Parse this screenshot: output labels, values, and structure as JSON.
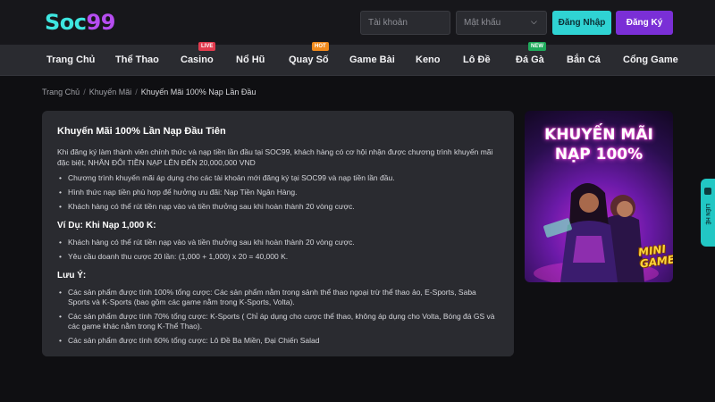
{
  "brand": {
    "logo_part1": "Soc",
    "logo_part2": "99"
  },
  "auth": {
    "username_placeholder": "Tài khoản",
    "password_placeholder": "Mật khẩu",
    "login_label": "Đăng Nhập",
    "register_label": "Đăng Ký"
  },
  "nav": {
    "items": [
      {
        "label": "Trang Chủ"
      },
      {
        "label": "Thể Thao"
      },
      {
        "label": "Casino",
        "badge": "LIVE"
      },
      {
        "label": "Nổ Hũ"
      },
      {
        "label": "Quay Số",
        "badge": "HOT"
      },
      {
        "label": "Game Bài"
      },
      {
        "label": "Keno"
      },
      {
        "label": "Lô Đề"
      },
      {
        "label": "Đá Gà",
        "badge": "NEW"
      },
      {
        "label": "Bắn Cá"
      },
      {
        "label": "Cổng Game"
      }
    ]
  },
  "breadcrumb": {
    "home": "Trang Chủ",
    "section": "Khuyến Mãi",
    "current": "Khuyến Mãi 100% Nạp Lần Đầu"
  },
  "article": {
    "title": "Khuyến Mãi 100% Lần Nạp Đầu Tiên",
    "intro": "Khi đăng ký làm thành viên chính thức và nạp tiền lần đầu tại SOC99, khách hàng có cơ hội nhận được chương trình khuyến mãi đặc biệt, NHÂN ĐÔI TIỀN NẠP LÊN ĐẾN 20,000,000 VND",
    "bullets": [
      "Chương trình khuyến mãi áp dụng cho các tài khoản mới đăng ký tại SOC99 và nạp tiền lần đầu.",
      "Hình thức nạp tiền phù hợp để hưởng ưu đãi: Nạp Tiền Ngân Hàng.",
      "Khách hàng có thể rút tiền nạp vào và tiền thưởng sau khi hoàn thành 20 vòng cược."
    ],
    "example_heading": "Ví Dụ: Khi Nạp 1,000 K:",
    "example_bullets": [
      "Khách hàng có thể rút tiền nạp vào và tiền thưởng sau khi hoàn thành 20 vòng cược.",
      "Yêu cầu doanh thu cược 20 lần: (1,000 + 1,000) x 20 = 40,000 K."
    ],
    "note_heading": "Lưu Ý:",
    "note_bullets": [
      "Các sản phẩm được tính 100% tổng cược: Các sản phẩm nằm trong sảnh thể thao ngoại trừ thể thao ảo, E-Sports, Saba Sports và K-Sports (bao gồm các game nằm trong K-Sports, Volta).",
      "Các sản phẩm được tính 70% tổng cược: K-Sports ( Chỉ áp dụng cho cược thể thao, không áp dụng cho Volta, Bóng đá GS và các game khác nằm trong K-Thể Thao).",
      "Các sản phẩm được tính 60% tổng cược: Lô Đề Ba Miền, Đại Chiến Salad"
    ]
  },
  "promo": {
    "line1": "KHUYẾN MÃI",
    "line2": "NẠP 100%",
    "mini_line1": "MINI",
    "mini_line2": "GAME"
  },
  "sidetab": {
    "label": "LIÊN HỆ"
  },
  "colors": {
    "accent_cyan": "#2fd3d3",
    "accent_purple": "#7a2fd6",
    "panel": "#2a2b30",
    "background": "#0f0f12"
  }
}
